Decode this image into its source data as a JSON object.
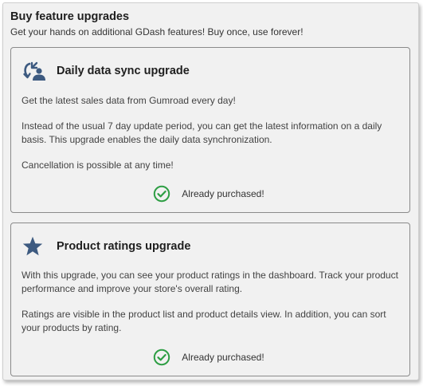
{
  "header": {
    "title": "Buy feature upgrades",
    "subtitle": "Get your hands on additional GDash features! Buy once, use forever!"
  },
  "colors": {
    "icon_blue": "#3d5a80",
    "success_green": "#2e9e44"
  },
  "upgrades": [
    {
      "icon": "sync-user-icon",
      "title": "Daily data sync upgrade",
      "paragraphs": [
        "Get the latest sales data from Gumroad every day!",
        "Instead of the usual 7 day update period, you can get the latest information on a daily basis. This upgrade enables the daily data synchronization.",
        "Cancellation is possible at any time!"
      ],
      "status": "Already purchased!"
    },
    {
      "icon": "star-icon",
      "title": "Product ratings upgrade",
      "paragraphs": [
        "With this upgrade, you can see your product ratings in the dashboard. Track your product performance and improve your store's overall rating.",
        "Ratings are visible in the product list and product details view. In addition, you can sort your products by rating."
      ],
      "status": "Already purchased!"
    }
  ]
}
